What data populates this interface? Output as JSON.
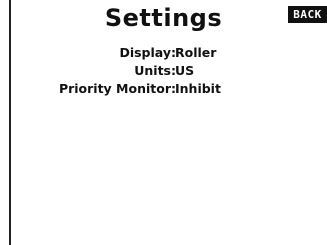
{
  "header": {
    "title": "Settings",
    "back_label": "BACK"
  },
  "settings": [
    {
      "label": "Display",
      "value": "Roller"
    },
    {
      "label": "Units",
      "value": "US"
    },
    {
      "label": "Priority Monitor",
      "value": "Inhibit"
    }
  ],
  "separator": ":",
  "colors": {
    "background": "#ffffff",
    "text": "#111111",
    "back_button_bg": "#111111",
    "back_button_text": "#ffffff"
  }
}
